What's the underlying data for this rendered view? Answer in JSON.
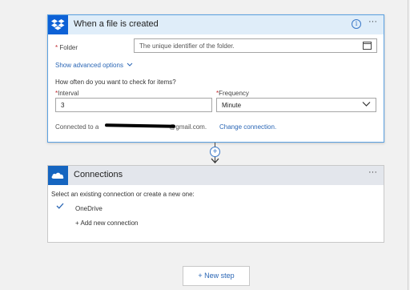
{
  "trigger_card": {
    "title": "When a file is created",
    "info_icon": "info-icon",
    "more_label": "···",
    "folder": {
      "required_mark": "*",
      "label": "Folder",
      "placeholder": "The unique identifier of the folder."
    },
    "advanced_link": "Show advanced options",
    "check_prompt": "How often do you want to check for items?",
    "interval": {
      "required_mark": "*",
      "label": "Interval",
      "value": "3"
    },
    "frequency": {
      "required_mark": "*",
      "label": "Frequency",
      "value": "Minute"
    },
    "connected_prefix": "Connected to a",
    "connected_suffix": "@gmail.com.",
    "change_connection": "Change connection."
  },
  "connections_card": {
    "title": "Connections",
    "more_label": "···",
    "prompt": "Select an existing connection or create a new one:",
    "items": [
      {
        "label": "OneDrive",
        "selected": true
      }
    ],
    "add_new": "+ Add new connection"
  },
  "new_step_label": "+ New step",
  "colors": {
    "accent": "#0d61d6",
    "link": "#2a66b5",
    "header_trigger": "#dfedf9",
    "header_connections": "#e3e6ec",
    "required": "#c0272d"
  }
}
